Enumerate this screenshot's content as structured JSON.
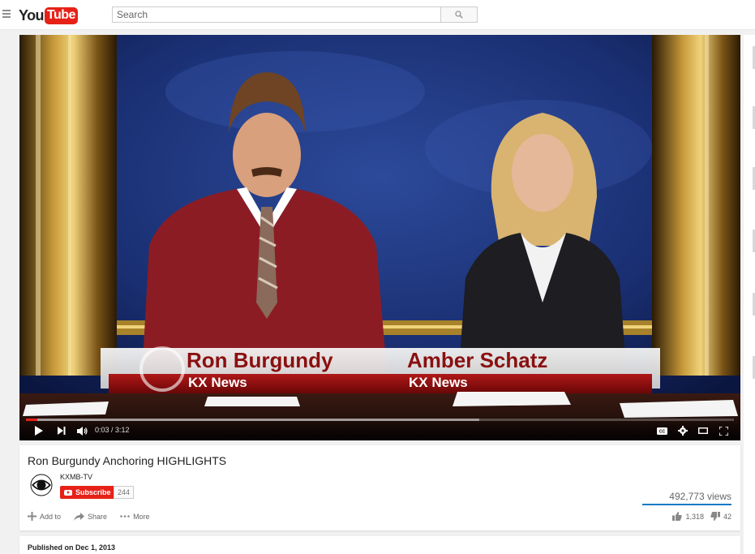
{
  "header": {
    "logo_you": "You",
    "logo_tube": "Tube",
    "search_placeholder": "Search"
  },
  "player": {
    "time_display": "0:03 / 3:12",
    "progress_played": 0.016,
    "progress_loaded": 0.64,
    "lower_third": {
      "left_name": "Ron Burgundy",
      "left_station": "KX News",
      "right_name": "Amber Schatz",
      "right_station": "KX News"
    }
  },
  "video": {
    "title": "Ron Burgundy Anchoring HIGHLIGHTS",
    "channel": "KXMB-TV",
    "subscribe_label": "Subscribe",
    "subscriber_count": "244",
    "views": "492,773 views",
    "actions": {
      "add_to": "Add to",
      "share": "Share",
      "more": "More"
    },
    "likes": "1,318",
    "dislikes": "42",
    "published": "Published on Dec 1, 2013"
  },
  "colors": {
    "brand_red": "#e62117",
    "link_blue": "#167ac6"
  },
  "icons": [
    "menu-icon",
    "search-icon",
    "play-icon",
    "next-icon",
    "volume-icon",
    "captions-icon",
    "settings-icon",
    "theater-icon",
    "fullscreen-icon",
    "cbs-eye-icon",
    "add-icon",
    "share-icon",
    "more-icon",
    "thumbs-up-icon",
    "thumbs-down-icon"
  ]
}
